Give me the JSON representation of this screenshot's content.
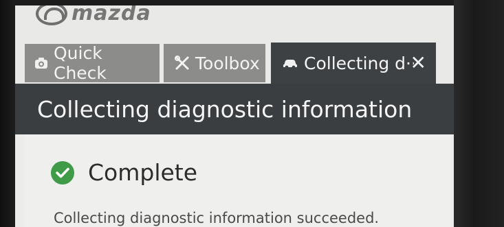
{
  "brand": {
    "logo_text": "mazda"
  },
  "tabs": [
    {
      "label": "Quick Check",
      "icon": "camera-icon"
    },
    {
      "label": "Toolbox",
      "icon": "tools-icon"
    },
    {
      "label": "Collecting d··",
      "icon": "car-icon",
      "active": true
    }
  ],
  "tab_close_label": "✕",
  "page": {
    "title": "Collecting diagnostic information"
  },
  "result": {
    "status": "Complete",
    "message": "Collecting diagnostic information succeeded."
  },
  "colors": {
    "tab_inactive": "#8c8c8a",
    "tab_active": "#3e4144",
    "titlebar": "#3b3e41",
    "success": "#3f9b47"
  }
}
